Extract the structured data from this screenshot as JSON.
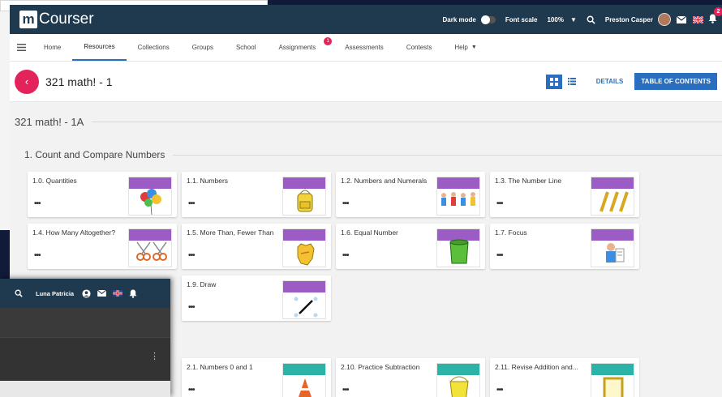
{
  "app": {
    "logo_letter": "m",
    "logo_text": "Courser"
  },
  "topbar": {
    "dark_mode_label": "Dark mode",
    "font_scale_label": "Font scale",
    "zoom": "100%",
    "user_name": "Preston Casper",
    "notification_count": "2"
  },
  "nav": {
    "items": [
      {
        "label": "Home"
      },
      {
        "label": "Resources"
      },
      {
        "label": "Collections"
      },
      {
        "label": "Groups"
      },
      {
        "label": "School"
      },
      {
        "label": "Assignments"
      },
      {
        "label": "Assessments"
      },
      {
        "label": "Contests"
      },
      {
        "label": "Help"
      }
    ],
    "assignments_badge": "1",
    "active": "Resources"
  },
  "title": {
    "text": "321 math! - 1",
    "details_label": "DETAILS",
    "toc_label": "TABLE OF CONTENTS"
  },
  "section": {
    "title": "321 math! - 1A",
    "sub_title": "1. Count and Compare Numbers"
  },
  "cards": [
    {
      "title": "1.0. Quantities",
      "dots": "•••"
    },
    {
      "title": "1.1. Numbers",
      "dots": "•••"
    },
    {
      "title": "1.2. Numbers and Numerals",
      "dots": "•••"
    },
    {
      "title": "1.3. The Number Line",
      "dots": "•••"
    },
    {
      "title": "1.4. How Many Altogether?",
      "dots": "•••"
    },
    {
      "title": "1.5. More Than, Fewer Than",
      "dots": "•••"
    },
    {
      "title": "1.6. Equal Number",
      "dots": "•••"
    },
    {
      "title": "1.7. Focus",
      "dots": "•••"
    },
    {
      "title": "",
      "dots": ""
    },
    {
      "title": "1.9. Draw",
      "dots": "•••"
    }
  ],
  "cards2": [
    {
      "title": "2.1. Numbers 0 and 1",
      "dots": "•••"
    },
    {
      "title": "2.10. Practice Subtraction",
      "dots": "•••"
    },
    {
      "title": "2.11. Revise Addition and...",
      "dots": "•••"
    }
  ],
  "colors": {
    "purple": "#9c5cc6",
    "teal": "#2bb3a8",
    "accent": "#e2245a",
    "blue": "#2a6fbf",
    "topbar": "#1f3a4f"
  },
  "overlay": {
    "user_name": "Luna Patricia"
  }
}
